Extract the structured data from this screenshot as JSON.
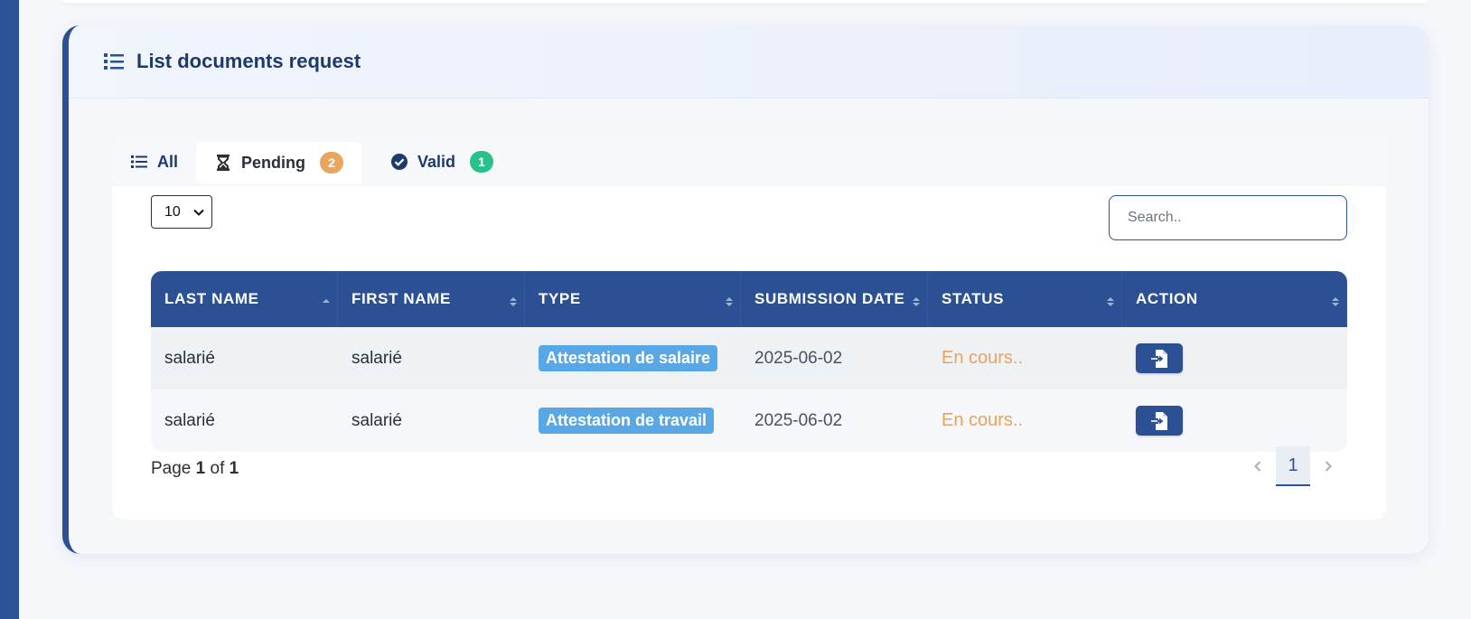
{
  "card": {
    "title": "List documents request"
  },
  "tabs": [
    {
      "label": "All",
      "icon": "list-icon",
      "count": null
    },
    {
      "label": "Pending",
      "icon": "hourglass-icon",
      "count": "2",
      "badge_color": "#e8a65e"
    },
    {
      "label": "Valid",
      "icon": "check-circle-icon",
      "count": "1",
      "badge_color": "#27c28a"
    }
  ],
  "controls": {
    "page_size": "10",
    "search_placeholder": "Search.."
  },
  "table": {
    "columns": [
      "LAST NAME",
      "FIRST NAME",
      "TYPE",
      "SUBMISSION DATE",
      "STATUS",
      "ACTION"
    ],
    "rows": [
      {
        "last_name": "salarié",
        "first_name": "salarié",
        "type": "Attestation de salaire",
        "date": "2025-06-02",
        "status": "En cours.."
      },
      {
        "last_name": "salarié",
        "first_name": "salarié",
        "type": "Attestation de travail",
        "date": "2025-06-02",
        "status": "En cours.."
      }
    ]
  },
  "pagination": {
    "prefix": "Page",
    "current": "1",
    "of": "of",
    "total": "1",
    "page_button": "1"
  },
  "colors": {
    "primary": "#2b5094",
    "status_pending": "#e9a35c",
    "type_pill": "#5aa7e6"
  }
}
